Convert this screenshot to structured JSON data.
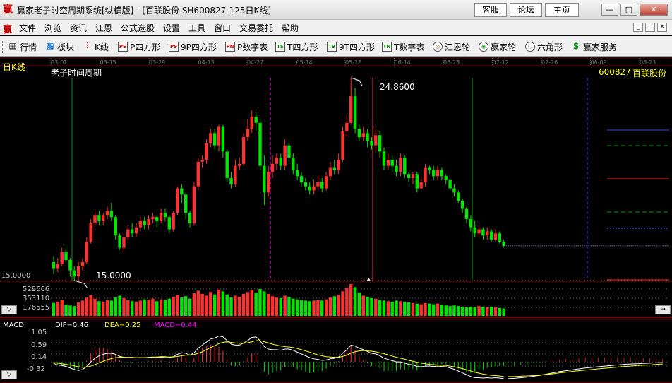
{
  "window": {
    "app_icon": "赢",
    "title": "赢家老子时空周期系统[纵横版] - [百联股份   SH600827-125日K线]",
    "buttons": [
      "客服",
      "论坛",
      "主页"
    ],
    "controls": [
      "—",
      "□",
      "✕"
    ]
  },
  "menu": {
    "items": [
      "文件",
      "浏览",
      "资讯",
      "江恩",
      "公式选股",
      "设置",
      "工具",
      "窗口",
      "交易委托",
      "帮助"
    ],
    "mdi_controls": [
      "_",
      "▫",
      "×"
    ]
  },
  "toolbar": {
    "items": [
      {
        "label": "行情",
        "icon": "grid-icon"
      },
      {
        "label": "板块",
        "icon": "board-icon"
      },
      {
        "label": "K线",
        "icon": "kline-icon"
      },
      {
        "label": "P四方形",
        "icon": "P",
        "icon_text": "PS"
      },
      {
        "label": "9P四方形",
        "icon": "P9",
        "icon_text": "P9"
      },
      {
        "label": "P数字表",
        "icon": "PN",
        "icon_text": "PN"
      },
      {
        "label": "T四方形",
        "icon": "TS",
        "icon_text": "TS"
      },
      {
        "label": "9T四方形",
        "icon": "T9",
        "icon_text": "T9"
      },
      {
        "label": "T数字表",
        "icon": "TN",
        "icon_text": "TN"
      },
      {
        "label": "江恩轮",
        "icon": "gann-wheel-icon"
      },
      {
        "label": "赢家轮",
        "icon": "winner-wheel-icon"
      },
      {
        "label": "六角形",
        "icon": "hexagon-icon"
      },
      {
        "label": "赢家服务",
        "icon": "dollar-icon"
      }
    ]
  },
  "chart_data": {
    "type": "candlestick",
    "period_label": "日K线",
    "title": "老子时间周期",
    "stock": {
      "code": "600827",
      "name": "百联股份"
    },
    "date_ticks": [
      "03-01",
      "03-15",
      "03-29",
      "04-13",
      "04-27",
      "05-14",
      "05-28",
      "06-14",
      "06-28",
      "07-12",
      "07-26",
      "08-09",
      "08-23"
    ],
    "price_axis": {
      "min_label": "15.0000"
    },
    "annotations": {
      "high": "24.8600",
      "low": "15.0000"
    },
    "volume_axis_ticks": [
      "529666",
      "353110",
      "176555"
    ],
    "macd": {
      "name": "MACD",
      "dif_label": "DIF=0.46",
      "dea_label": "DEA=0.25",
      "macd_label": "MACD=0.44",
      "y_ticks": [
        "1.05",
        "0.59",
        "0.14",
        "-0.32"
      ]
    },
    "colors": {
      "up": "#ff3232",
      "down": "#54fcfc",
      "down_fill": "#00e600",
      "dif": "#ffffff",
      "dea": "#ffff00",
      "macd_label": "#ff00ff"
    },
    "candles": [
      [
        15.9,
        15.6,
        16.2,
        15.3
      ],
      [
        15.6,
        15.8,
        16.1,
        15.4
      ],
      [
        15.8,
        16.4,
        16.6,
        15.7
      ],
      [
        16.4,
        16.0,
        16.7,
        15.8
      ],
      [
        16.0,
        15.5,
        16.1,
        15.2
      ],
      [
        15.5,
        15.2,
        15.7,
        15.0
      ],
      [
        15.2,
        15.7,
        15.9,
        15.0
      ],
      [
        15.7,
        15.9,
        16.1,
        15.5
      ],
      [
        15.9,
        16.9,
        17.1,
        15.8
      ],
      [
        16.9,
        17.8,
        18.0,
        16.8
      ],
      [
        17.8,
        18.2,
        18.4,
        17.6
      ],
      [
        18.2,
        17.9,
        18.4,
        17.7
      ],
      [
        17.9,
        18.2,
        18.3,
        17.7
      ],
      [
        18.2,
        18.4,
        18.6,
        18.0
      ],
      [
        18.4,
        18.1,
        18.8,
        17.9
      ],
      [
        18.1,
        17.2,
        18.2,
        17.0
      ],
      [
        17.2,
        16.6,
        17.3,
        16.5
      ],
      [
        16.6,
        17.1,
        17.3,
        16.4
      ],
      [
        17.1,
        17.5,
        17.7,
        16.9
      ],
      [
        17.5,
        17.3,
        17.8,
        17.1
      ],
      [
        17.3,
        17.6,
        17.8,
        17.1
      ],
      [
        17.6,
        17.9,
        18.1,
        17.4
      ],
      [
        17.9,
        17.7,
        18.1,
        17.5
      ],
      [
        17.7,
        18.0,
        18.2,
        17.5
      ],
      [
        18.0,
        18.1,
        18.3,
        17.8
      ],
      [
        18.1,
        17.9,
        18.2,
        17.6
      ],
      [
        17.9,
        18.3,
        18.5,
        17.8
      ],
      [
        18.3,
        18.1,
        18.5,
        17.9
      ],
      [
        18.1,
        17.5,
        18.2,
        17.3
      ],
      [
        17.5,
        18.3,
        18.4,
        17.4
      ],
      [
        18.3,
        19.5,
        19.6,
        18.2
      ],
      [
        19.5,
        19.2,
        19.7,
        18.8
      ],
      [
        19.2,
        18.3,
        19.3,
        18.0
      ],
      [
        18.3,
        17.8,
        18.4,
        17.6
      ],
      [
        17.8,
        19.6,
        19.8,
        17.7
      ],
      [
        19.6,
        20.8,
        21.0,
        19.4
      ],
      [
        20.8,
        20.9,
        21.1,
        20.5
      ],
      [
        20.9,
        21.7,
        21.9,
        20.7
      ],
      [
        21.7,
        22.2,
        22.4,
        21.5
      ],
      [
        22.2,
        21.6,
        22.4,
        21.4
      ],
      [
        21.6,
        22.5,
        22.6,
        21.3
      ],
      [
        22.5,
        21.3,
        22.6,
        21.0
      ],
      [
        21.3,
        20.0,
        21.4,
        19.8
      ],
      [
        20.0,
        19.7,
        20.3,
        19.5
      ],
      [
        19.7,
        20.6,
        20.9,
        19.6
      ],
      [
        20.6,
        20.7,
        21.0,
        20.4
      ],
      [
        20.7,
        22.0,
        22.2,
        20.6
      ],
      [
        22.0,
        22.4,
        22.9,
        21.8
      ],
      [
        22.4,
        23.0,
        23.3,
        22.2
      ],
      [
        23.0,
        22.7,
        23.2,
        22.3
      ],
      [
        22.7,
        20.6,
        22.9,
        20.4
      ],
      [
        20.6,
        19.3,
        21.1,
        18.7
      ],
      [
        19.3,
        20.3,
        20.6,
        19.1
      ],
      [
        20.3,
        20.7,
        21.1,
        20.0
      ],
      [
        20.7,
        21.0,
        21.2,
        20.4
      ],
      [
        21.0,
        20.6,
        21.2,
        20.4
      ],
      [
        20.6,
        21.6,
        21.9,
        20.4
      ],
      [
        21.6,
        21.0,
        21.8,
        20.8
      ],
      [
        21.0,
        20.4,
        21.2,
        20.2
      ],
      [
        20.4,
        20.1,
        20.7,
        19.9
      ],
      [
        20.1,
        19.8,
        20.3,
        19.6
      ],
      [
        19.8,
        19.6,
        20.0,
        19.4
      ],
      [
        19.6,
        19.4,
        19.8,
        19.2
      ],
      [
        19.4,
        19.6,
        19.9,
        19.2
      ],
      [
        19.6,
        19.8,
        20.1,
        19.4
      ],
      [
        19.8,
        19.5,
        20.0,
        19.3
      ],
      [
        19.5,
        20.1,
        20.3,
        19.4
      ],
      [
        20.1,
        20.5,
        20.8,
        19.9
      ],
      [
        20.5,
        20.4,
        20.9,
        20.2
      ],
      [
        20.4,
        20.9,
        21.2,
        20.2
      ],
      [
        20.9,
        22.3,
        22.5,
        20.8
      ],
      [
        22.3,
        22.7,
        23.1,
        22.0
      ],
      [
        22.7,
        24.0,
        24.9,
        22.6
      ],
      [
        24.0,
        22.4,
        24.4,
        22.2
      ],
      [
        22.4,
        22.0,
        22.6,
        21.8
      ],
      [
        22.0,
        22.2,
        22.5,
        21.8
      ],
      [
        22.2,
        21.8,
        22.4,
        21.5
      ],
      [
        21.8,
        21.6,
        22.0,
        21.4
      ],
      [
        21.6,
        22.1,
        22.4,
        21.3
      ],
      [
        22.1,
        21.3,
        22.3,
        21.0
      ],
      [
        21.3,
        20.6,
        21.5,
        20.4
      ],
      [
        20.6,
        20.9,
        21.2,
        20.4
      ],
      [
        20.9,
        20.6,
        21.1,
        20.3
      ],
      [
        20.6,
        20.3,
        20.9,
        20.1
      ],
      [
        20.3,
        21.0,
        21.2,
        20.1
      ],
      [
        21.0,
        20.2,
        21.1,
        20.0
      ],
      [
        20.2,
        20.0,
        20.3,
        19.8
      ],
      [
        20.0,
        20.2,
        20.3,
        19.7
      ],
      [
        20.2,
        19.5,
        20.3,
        19.3
      ],
      [
        19.5,
        19.8,
        20.1,
        19.5
      ],
      [
        19.8,
        20.5,
        20.7,
        19.6
      ],
      [
        20.5,
        20.4,
        20.6,
        20.2
      ],
      [
        20.4,
        20.1,
        20.6,
        19.9
      ],
      [
        20.1,
        20.4,
        20.6,
        19.9
      ],
      [
        20.4,
        20.1,
        20.5,
        19.9
      ],
      [
        20.1,
        19.9,
        20.2,
        19.7
      ],
      [
        19.9,
        19.5,
        20.0,
        19.4
      ],
      [
        19.5,
        19.3,
        19.7,
        19.1
      ],
      [
        19.3,
        18.9,
        19.4,
        18.8
      ],
      [
        18.9,
        18.5,
        19.0,
        18.3
      ],
      [
        18.5,
        18.0,
        18.6,
        17.8
      ],
      [
        18.0,
        17.6,
        18.2,
        17.4
      ],
      [
        17.6,
        17.3,
        17.9,
        17.1
      ],
      [
        17.3,
        17.5,
        17.7,
        17.1
      ],
      [
        17.5,
        17.2,
        17.6,
        17.0
      ],
      [
        17.2,
        17.4,
        17.6,
        17.0
      ],
      [
        17.4,
        17.0,
        17.5,
        16.9
      ],
      [
        17.0,
        17.3,
        17.5,
        16.9
      ],
      [
        17.3,
        16.9,
        17.4,
        16.8
      ],
      [
        16.9,
        16.7,
        17.0,
        16.6
      ]
    ],
    "volumes": [
      210,
      230,
      260,
      180,
      170,
      160,
      220,
      250,
      300,
      340,
      280,
      240,
      230,
      260,
      250,
      300,
      330,
      290,
      260,
      240,
      230,
      250,
      270,
      260,
      280,
      240,
      270,
      260,
      280,
      310,
      340,
      300,
      320,
      280,
      370,
      410,
      360,
      330,
      390,
      350,
      430,
      400,
      350,
      300,
      330,
      310,
      360,
      390,
      420,
      380,
      440,
      400,
      360,
      320,
      300,
      290,
      330,
      310,
      280,
      270,
      260,
      250,
      240,
      250,
      260,
      250,
      270,
      300,
      320,
      340,
      400,
      460,
      520,
      470,
      380,
      330,
      310,
      290,
      280,
      260,
      250,
      240,
      230,
      250,
      240,
      230,
      220,
      210,
      200,
      190,
      210,
      200,
      190,
      200,
      180,
      170,
      160,
      170,
      160,
      150,
      140,
      150,
      140,
      160,
      150,
      140,
      150,
      140,
      130,
      120
    ],
    "macd_series": {
      "dif": [
        -0.05,
        -0.1,
        -0.12,
        -0.15,
        -0.2,
        -0.25,
        -0.28,
        -0.25,
        -0.15,
        0.0,
        0.12,
        0.2,
        0.25,
        0.28,
        0.28,
        0.25,
        0.18,
        0.15,
        0.14,
        0.13,
        0.13,
        0.14,
        0.14,
        0.15,
        0.16,
        0.16,
        0.17,
        0.17,
        0.15,
        0.17,
        0.25,
        0.3,
        0.28,
        0.22,
        0.3,
        0.45,
        0.55,
        0.65,
        0.75,
        0.78,
        0.85,
        0.82,
        0.7,
        0.58,
        0.55,
        0.55,
        0.62,
        0.7,
        0.8,
        0.82,
        0.7,
        0.5,
        0.42,
        0.4,
        0.4,
        0.38,
        0.42,
        0.42,
        0.38,
        0.32,
        0.26,
        0.2,
        0.14,
        0.1,
        0.08,
        0.05,
        0.06,
        0.1,
        0.12,
        0.16,
        0.28,
        0.4,
        0.55,
        0.52,
        0.45,
        0.4,
        0.34,
        0.28,
        0.26,
        0.2,
        0.12,
        0.08,
        0.04,
        0.0,
        0.0,
        -0.04,
        -0.08,
        -0.1,
        -0.15,
        -0.16,
        -0.14,
        -0.14,
        -0.15,
        -0.14,
        -0.15,
        -0.16,
        -0.2,
        -0.24,
        -0.3,
        -0.36,
        -0.42,
        -0.48,
        -0.52,
        -0.52,
        -0.53,
        -0.52,
        -0.53,
        -0.52,
        -0.53,
        -0.55
      ],
      "dea": [
        -0.02,
        -0.04,
        -0.06,
        -0.08,
        -0.1,
        -0.13,
        -0.16,
        -0.18,
        -0.17,
        -0.14,
        -0.09,
        -0.03,
        0.02,
        0.07,
        0.11,
        0.14,
        0.15,
        0.15,
        0.15,
        0.15,
        0.14,
        0.14,
        0.14,
        0.14,
        0.15,
        0.15,
        0.15,
        0.16,
        0.16,
        0.16,
        0.18,
        0.2,
        0.22,
        0.22,
        0.24,
        0.28,
        0.33,
        0.4,
        0.47,
        0.53,
        0.6,
        0.64,
        0.66,
        0.64,
        0.62,
        0.61,
        0.61,
        0.63,
        0.66,
        0.7,
        0.7,
        0.66,
        0.62,
        0.58,
        0.55,
        0.52,
        0.5,
        0.49,
        0.47,
        0.44,
        0.4,
        0.36,
        0.32,
        0.27,
        0.23,
        0.2,
        0.17,
        0.16,
        0.15,
        0.15,
        0.18,
        0.22,
        0.29,
        0.33,
        0.36,
        0.37,
        0.36,
        0.35,
        0.33,
        0.3,
        0.27,
        0.23,
        0.19,
        0.15,
        0.12,
        0.09,
        0.05,
        0.02,
        -0.01,
        -0.04,
        -0.06,
        -0.08,
        -0.09,
        -0.1,
        -0.11,
        -0.12,
        -0.14,
        -0.16,
        -0.19,
        -0.22,
        -0.26,
        -0.3,
        -0.34,
        -0.37,
        -0.4,
        -0.42,
        -0.44,
        -0.45,
        -0.46,
        -0.48
      ]
    },
    "projection": {
      "dif": [
        -0.55,
        -0.54,
        -0.52,
        -0.5,
        -0.47,
        -0.44,
        -0.4,
        -0.36,
        -0.32,
        -0.29,
        -0.26,
        -0.23,
        -0.2,
        -0.18,
        -0.16,
        -0.14,
        -0.12,
        -0.1,
        -0.08,
        -0.07,
        -0.06,
        -0.05,
        -0.04,
        -0.03,
        -0.02
      ],
      "dea": [
        -0.48,
        -0.48,
        -0.47,
        -0.46,
        -0.45,
        -0.43,
        -0.41,
        -0.39,
        -0.36,
        -0.34,
        -0.31,
        -0.29,
        -0.27,
        -0.25,
        -0.23,
        -0.21,
        -0.19,
        -0.17,
        -0.15,
        -0.14,
        -0.12,
        -0.11,
        -0.1,
        -0.08,
        -0.07
      ]
    }
  }
}
